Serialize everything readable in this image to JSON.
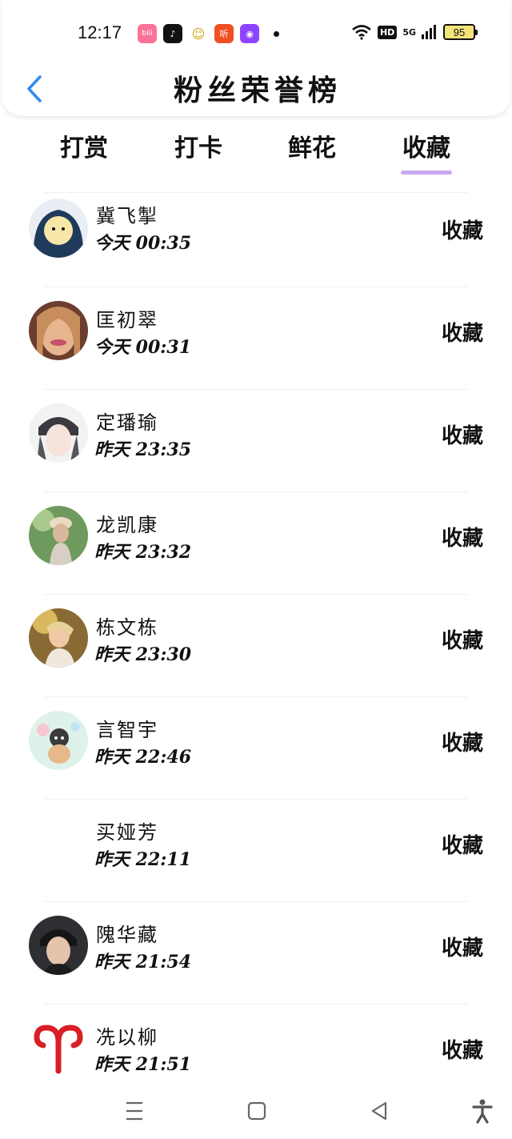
{
  "status_bar": {
    "time": "12:17",
    "apps": [
      {
        "icon": "bilibili-icon",
        "color": "#fb7299",
        "glyph": "bili"
      },
      {
        "icon": "douyin-icon",
        "color": "#111111",
        "glyph": "♪"
      },
      {
        "icon": "mascot-icon",
        "color": "#ffd84d",
        "glyph": "☺"
      },
      {
        "icon": "listen-icon",
        "color": "#f04e23",
        "glyph": "听"
      },
      {
        "icon": "camera-app-icon",
        "color": "#8e44ff",
        "glyph": "◉"
      }
    ],
    "hd_label": "HD",
    "network": "5G",
    "battery": "95"
  },
  "header": {
    "title": "粉丝荣誉榜"
  },
  "tabs": [
    {
      "label": "打赏"
    },
    {
      "label": "打卡"
    },
    {
      "label": "鲜花"
    },
    {
      "label": "收藏"
    }
  ],
  "active_tab": 3,
  "accent_color": "#c9a7ee",
  "list": [
    {
      "name": "冀飞掣",
      "time": "今天 00:35",
      "action": "收藏",
      "avatar": "cartoon"
    },
    {
      "name": "匡初翠",
      "time": "今天 00:31",
      "action": "收藏",
      "avatar": "photo-warm"
    },
    {
      "name": "定璠瑜",
      "time": "昨天 23:35",
      "action": "收藏",
      "avatar": "anime-gray"
    },
    {
      "name": "龙凯康",
      "time": "昨天 23:32",
      "action": "收藏",
      "avatar": "photo-green"
    },
    {
      "name": "栋文栋",
      "time": "昨天 23:30",
      "action": "收藏",
      "avatar": "photo-gold"
    },
    {
      "name": "言智宇",
      "time": "昨天 22:46",
      "action": "收藏",
      "avatar": "cartoon-teal"
    },
    {
      "name": "买娅芳",
      "time": "昨天 22:11",
      "action": "收藏",
      "avatar": "blank"
    },
    {
      "name": "隗华藏",
      "time": "昨天 21:54",
      "action": "收藏",
      "avatar": "photo-dark"
    },
    {
      "name": "冼以柳",
      "time": "昨天 21:51",
      "action": "收藏",
      "avatar": "aries"
    }
  ]
}
